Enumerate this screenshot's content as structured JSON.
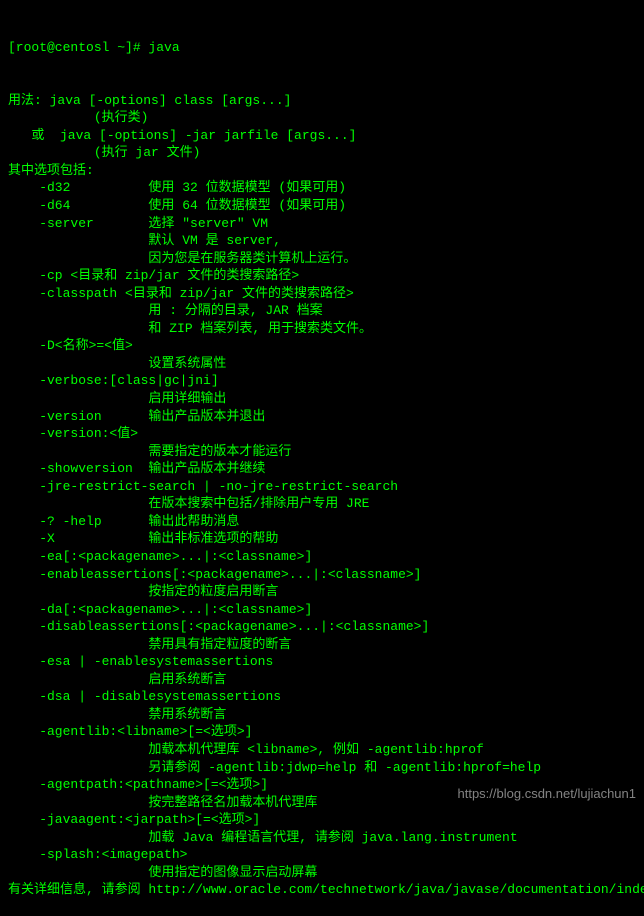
{
  "prompt": "[root@centosl ~]# java",
  "lines": [
    "用法: java [-options] class [args...]",
    "           (执行类)",
    "   或  java [-options] -jar jarfile [args...]",
    "           (执行 jar 文件)",
    "其中选项包括:",
    "    -d32          使用 32 位数据模型 (如果可用)",
    "    -d64          使用 64 位数据模型 (如果可用)",
    "    -server       选择 \"server\" VM",
    "                  默认 VM 是 server,",
    "                  因为您是在服务器类计算机上运行。",
    "",
    "",
    "    -cp <目录和 zip/jar 文件的类搜索路径>",
    "    -classpath <目录和 zip/jar 文件的类搜索路径>",
    "                  用 : 分隔的目录, JAR 档案",
    "                  和 ZIP 档案列表, 用于搜索类文件。",
    "    -D<名称>=<值>",
    "                  设置系统属性",
    "    -verbose:[class|gc|jni]",
    "                  启用详细输出",
    "    -version      输出产品版本并退出",
    "    -version:<值>",
    "                  需要指定的版本才能运行",
    "    -showversion  输出产品版本并继续",
    "    -jre-restrict-search | -no-jre-restrict-search",
    "                  在版本搜索中包括/排除用户专用 JRE",
    "    -? -help      输出此帮助消息",
    "    -X            输出非标准选项的帮助",
    "    -ea[:<packagename>...|:<classname>]",
    "    -enableassertions[:<packagename>...|:<classname>]",
    "                  按指定的粒度启用断言",
    "    -da[:<packagename>...|:<classname>]",
    "    -disableassertions[:<packagename>...|:<classname>]",
    "                  禁用具有指定粒度的断言",
    "    -esa | -enablesystemassertions",
    "                  启用系统断言",
    "    -dsa | -disablesystemassertions",
    "                  禁用系统断言",
    "    -agentlib:<libname>[=<选项>]",
    "                  加载本机代理库 <libname>, 例如 -agentlib:hprof",
    "                  另请参阅 -agentlib:jdwp=help 和 -agentlib:hprof=help",
    "    -agentpath:<pathname>[=<选项>]",
    "                  按完整路径名加载本机代理库",
    "    -javaagent:<jarpath>[=<选项>]",
    "                  加载 Java 编程语言代理, 请参阅 java.lang.instrument",
    "    -splash:<imagepath>",
    "                  使用指定的图像显示启动屏幕",
    "有关详细信息, 请参阅 http://www.oracle.com/technetwork/java/javase/documentation/index.html。"
  ],
  "watermark": "https://blog.csdn.net/lujiachun1"
}
